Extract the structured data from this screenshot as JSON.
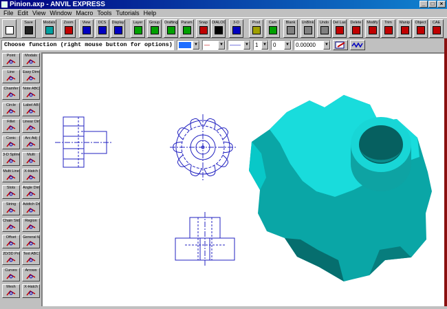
{
  "window": {
    "title": "Pinion.axp - ANVIL EXPRESS",
    "minimize": "_",
    "maximize": "□",
    "close": "×"
  },
  "menu": [
    "File",
    "Edit",
    "View",
    "Window",
    "Macro",
    "Tools",
    "Tutorials",
    "Help"
  ],
  "toolbar": [
    {
      "label": "",
      "icon": "new-file-icon",
      "color": "#ffffff"
    },
    {
      "label": "Save",
      "icon": "save-icon",
      "color": "#202020"
    },
    {
      "label": "Modals",
      "icon": "modals-icon",
      "color": "#00a0a0"
    },
    {
      "label": "Zoom",
      "icon": "zoom-icon",
      "color": "#c00000"
    },
    {
      "label": "View",
      "icon": "view-icon",
      "color": "#0000c0"
    },
    {
      "label": "DCS",
      "icon": "dcs-icon",
      "color": "#0000c0"
    },
    {
      "label": "Display",
      "icon": "display-icon",
      "color": "#0000c0"
    },
    {
      "label": "Layer",
      "icon": "layer-icon",
      "color": "#00a000"
    },
    {
      "label": "Group",
      "icon": "group-icon",
      "color": "#00a000"
    },
    {
      "label": "Drafting",
      "icon": "drafting-icon",
      "color": "#00a000"
    },
    {
      "label": "Param",
      "icon": "param-icon",
      "color": "#00a000"
    },
    {
      "label": "Snap",
      "icon": "snap-icon",
      "color": "#c00000"
    },
    {
      "label": "DIALOG",
      "icon": "dialog-icon",
      "color": "#000000"
    },
    {
      "label": "3-D",
      "icon": "3d-icon",
      "color": "#0000c0"
    },
    {
      "label": "Prod",
      "icon": "prod-icon",
      "color": "#a0a000"
    },
    {
      "label": "Cam",
      "icon": "cam-icon",
      "color": "#00a000"
    },
    {
      "label": "Blank",
      "icon": "blank-icon",
      "color": "#808080"
    },
    {
      "label": "UnBlnk",
      "icon": "unblank-icon",
      "color": "#808080"
    },
    {
      "label": "Undo",
      "icon": "undo-icon",
      "color": "#808080"
    },
    {
      "label": "Del Last",
      "icon": "delete-last-icon",
      "color": "#c00000"
    },
    {
      "label": "Delete",
      "icon": "delete-icon",
      "color": "#c00000"
    },
    {
      "label": "Modify",
      "icon": "modify-icon",
      "color": "#c00000"
    },
    {
      "label": "Trim",
      "icon": "trim-icon",
      "color": "#c00000"
    },
    {
      "label": "Manip",
      "icon": "manip-icon",
      "color": "#c00000"
    },
    {
      "label": "Object",
      "icon": "object-icon",
      "color": "#c00000"
    },
    {
      "label": "CAE",
      "icon": "cae-icon",
      "color": "#c00000"
    }
  ],
  "options": {
    "prompt": "Choose function (right mouse button for options)",
    "color_swatch": "#1e6eff",
    "line_style": "—",
    "line_weight": "——",
    "pen": "1",
    "layer": "0",
    "value": "0.00000"
  },
  "sidebar": [
    {
      "label": "Point",
      "icon": "point-icon"
    },
    {
      "label": "Modals",
      "icon": "modals-icon"
    },
    {
      "label": "Line",
      "icon": "line-icon"
    },
    {
      "label": "Easy Dimen",
      "icon": "easy-dimension-icon"
    },
    {
      "label": "Chamfer",
      "icon": "chamfer-icon"
    },
    {
      "label": "Note ABC",
      "icon": "note-icon"
    },
    {
      "label": "Circle",
      "icon": "circle-icon"
    },
    {
      "label": "Label AB",
      "icon": "label-icon"
    },
    {
      "label": "Fillet",
      "icon": "fillet-icon"
    },
    {
      "label": "Linear Dimen",
      "icon": "linear-dimension-icon"
    },
    {
      "label": "Conic",
      "icon": "conic-icon"
    },
    {
      "label": "Arc Adj",
      "icon": "arc-adjust-icon"
    },
    {
      "label": "3-D Spline",
      "icon": "spline-icon"
    },
    {
      "label": "Multi",
      "icon": "multi-icon"
    },
    {
      "label": "Multi Line",
      "icon": "multi-line-icon"
    },
    {
      "label": "X-Hatch",
      "icon": "crosshatch-icon"
    },
    {
      "label": "Slots",
      "icon": "slots-icon"
    },
    {
      "label": "Angle Dimen",
      "icon": "angle-dimension-icon"
    },
    {
      "label": "String",
      "icon": "string-icon"
    },
    {
      "label": "Addtch Draft",
      "icon": "attach-draft-icon"
    },
    {
      "label": "Chain Sktch",
      "icon": "chain-sketch-icon"
    },
    {
      "label": "Region",
      "icon": "region-icon"
    },
    {
      "label": "Offset",
      "icon": "offset-icon"
    },
    {
      "label": "General Modify",
      "icon": "general-modify-icon"
    },
    {
      "label": "2D/3D Project",
      "icon": "project-icon"
    },
    {
      "label": "Text ABC",
      "icon": "text-icon"
    },
    {
      "label": "Curves",
      "icon": "curves-icon"
    },
    {
      "label": "Arrows",
      "icon": "arrows-icon"
    },
    {
      "label": "Mesh",
      "icon": "mesh-icon"
    },
    {
      "label": "X-Hatch",
      "icon": "crosshatch2-icon"
    }
  ]
}
